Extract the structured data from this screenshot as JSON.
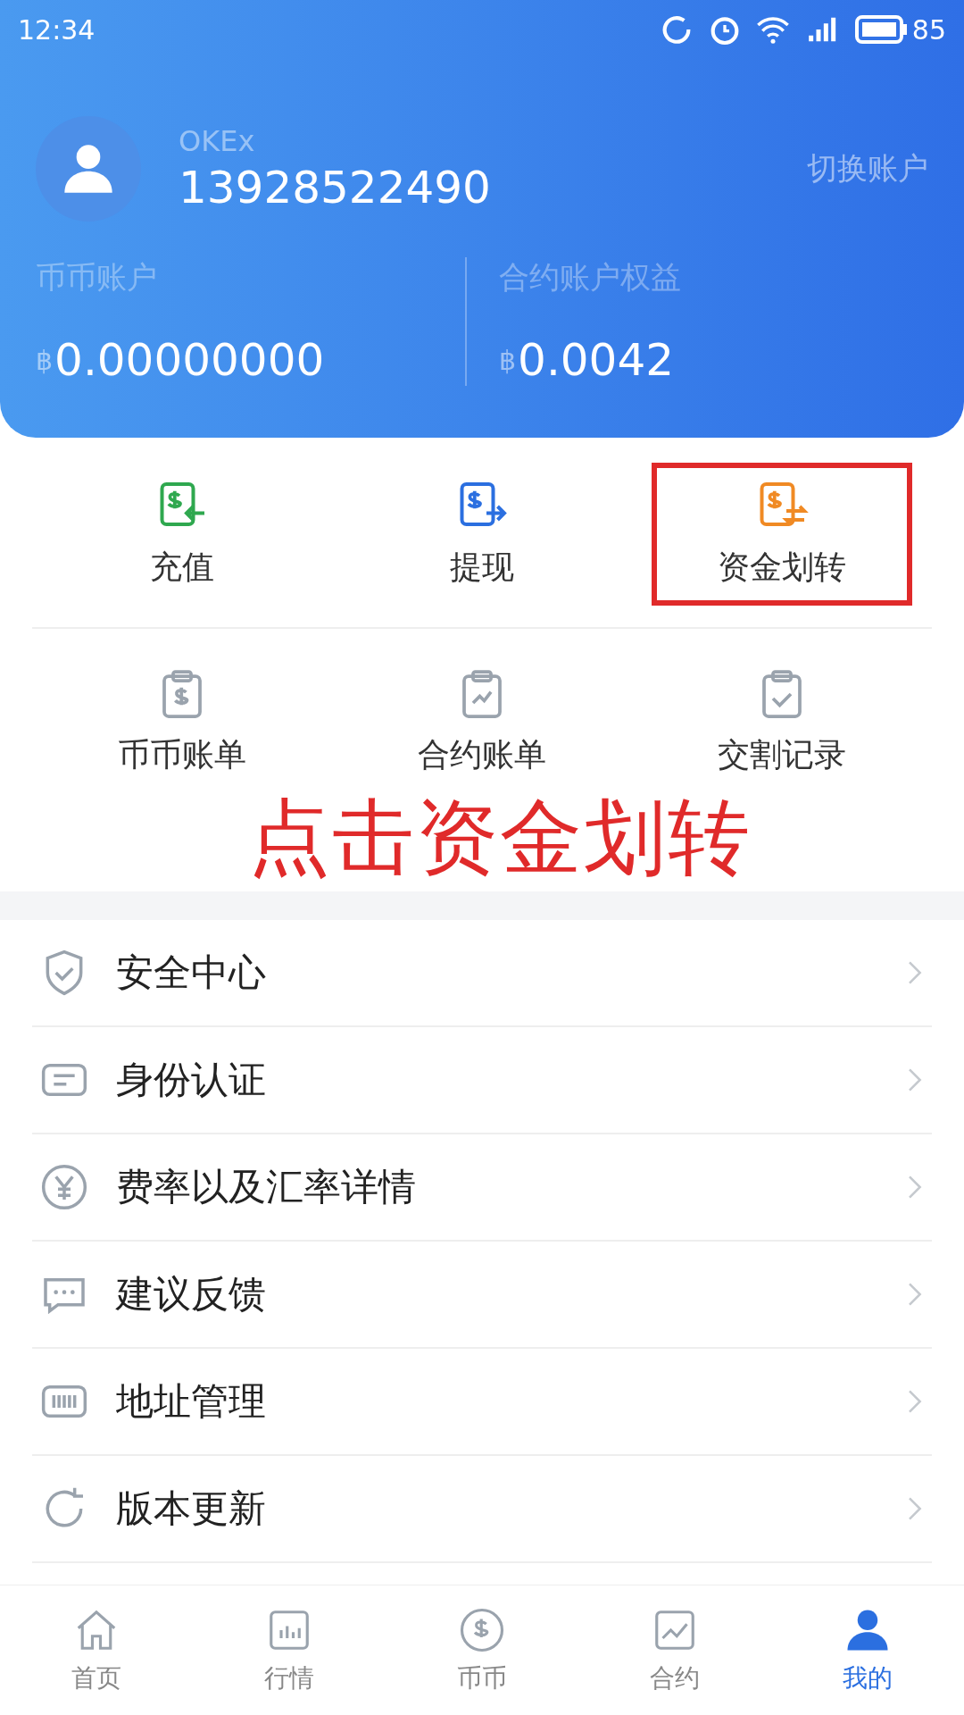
{
  "status_bar": {
    "time": "12:34",
    "battery": "85"
  },
  "account": {
    "exchange": "OKEx",
    "phone": "13928522490",
    "switch": "切换账户"
  },
  "balances": [
    {
      "label": "币币账户",
      "symbol": "฿",
      "amount": "0.00000000"
    },
    {
      "label": "合约账户权益",
      "symbol": "฿",
      "amount": "0.0042"
    }
  ],
  "actions": [
    {
      "label": "充值",
      "kind": "deposit",
      "color": "#2fa84f",
      "highlighted": false
    },
    {
      "label": "提现",
      "kind": "withdraw",
      "color": "#2b6fe0",
      "highlighted": false
    },
    {
      "label": "资金划转",
      "kind": "transfer",
      "color": "#f08a24",
      "highlighted": true
    },
    {
      "label": "币币账单",
      "kind": "coin-bill",
      "color": "#9aa3ad",
      "highlighted": false
    },
    {
      "label": "合约账单",
      "kind": "contract-bill",
      "color": "#9aa3ad",
      "highlighted": false
    },
    {
      "label": "交割记录",
      "kind": "delivery-record",
      "color": "#9aa3ad",
      "highlighted": false
    }
  ],
  "annotation": {
    "text": "点击资金划转"
  },
  "menu": [
    {
      "label": "安全中心",
      "kind": "shield"
    },
    {
      "label": "身份认证",
      "kind": "card"
    },
    {
      "label": "费率以及汇率详情",
      "kind": "yen"
    },
    {
      "label": "建议反馈",
      "kind": "chat"
    },
    {
      "label": "地址管理",
      "kind": "barcode"
    },
    {
      "label": "版本更新",
      "kind": "refresh"
    }
  ],
  "nav": [
    {
      "label": "首页",
      "kind": "home",
      "selected": false
    },
    {
      "label": "行情",
      "kind": "bars",
      "selected": false
    },
    {
      "label": "币币",
      "kind": "coin",
      "selected": false
    },
    {
      "label": "合约",
      "kind": "trend",
      "selected": false
    },
    {
      "label": "我的",
      "kind": "person",
      "selected": true
    }
  ]
}
